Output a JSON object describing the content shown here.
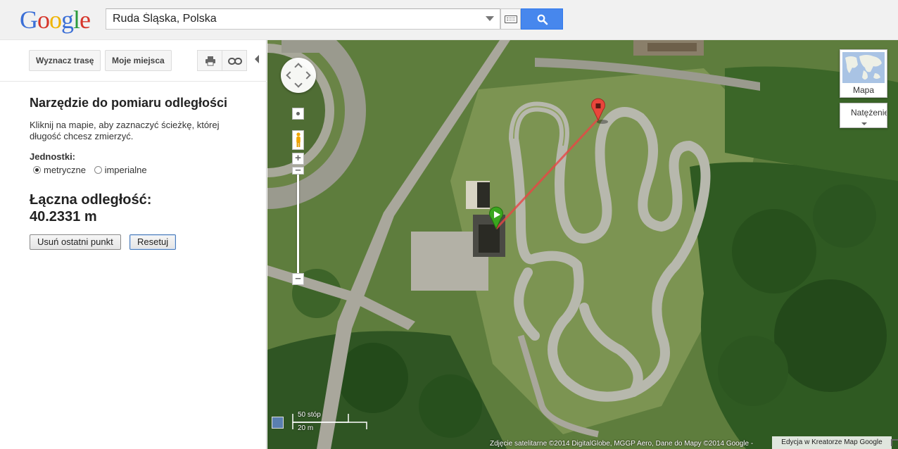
{
  "header": {
    "logo_text": "Google",
    "search_value": "Ruda Śląska, Polska"
  },
  "toolbar": {
    "route_label": "Wyznacz trasę",
    "myplaces_label": "Moje miejsca"
  },
  "panel": {
    "title": "Narzędzie do pomiaru odległości",
    "description": "Kliknij na mapie, aby zaznaczyć ścieżkę, której długość chcesz zmierzyć.",
    "units_label": "Jednostki:",
    "unit_metric": "metryczne",
    "unit_imperial": "imperialne",
    "selected_unit": "metryczne",
    "total_label": "Łączna odległość:",
    "total_value": "40.2331 m",
    "undo_label": "Usuń ostatni punkt",
    "reset_label": "Resetuj"
  },
  "map": {
    "maptype_label": "Mapa",
    "traffic_label": "Natężenie",
    "scale_imperial": "50 stóp",
    "scale_metric": "20 m",
    "copyright": "Zdjęcie satelitarne ©2014 DigitalGlobe, MGGP Aero, Dane do Mapy ©2014 Google -",
    "kreator_label": "Edycja w Kreatorze Map Google",
    "start_marker_color": "#3aa61e",
    "end_marker_color": "#e9463b",
    "measure_line_color": "#e84545"
  },
  "colors": {
    "search_button": "#4787ed",
    "logo_blue": "#3b6fd6",
    "logo_red": "#d6362b",
    "logo_yellow": "#f0b400",
    "logo_green": "#2b9a3c"
  }
}
